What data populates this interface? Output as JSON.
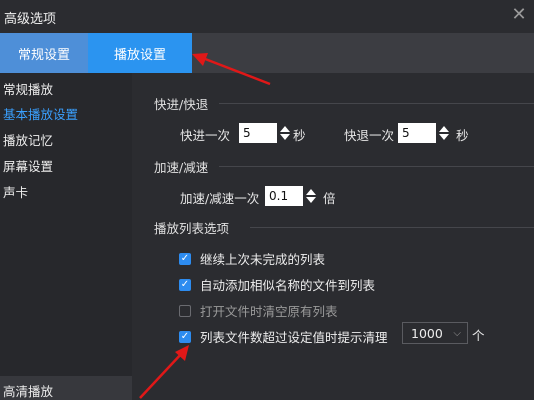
{
  "window": {
    "title": "高级选项",
    "close_glyph": "✕"
  },
  "tabs": [
    {
      "label": "常规设置"
    },
    {
      "label": "播放设置"
    }
  ],
  "sidebar": {
    "items": [
      {
        "label": "常规播放"
      },
      {
        "label": "基本播放设置"
      },
      {
        "label": "播放记忆"
      },
      {
        "label": "屏幕设置"
      },
      {
        "label": "声卡"
      }
    ],
    "bottom": "高清播放"
  },
  "sections": {
    "seek": {
      "title": "快进/快退",
      "forward_label": "快进一次",
      "forward_value": "5",
      "forward_unit": "秒",
      "backward_label": "快退一次",
      "backward_value": "5",
      "backward_unit": "秒"
    },
    "speed": {
      "title": "加速/减速",
      "label": "加速/减速一次",
      "value": "0.1",
      "unit": "倍"
    },
    "playlist": {
      "title": "播放列表选项",
      "options": [
        {
          "label": "继续上次未完成的列表",
          "checked": true
        },
        {
          "label": "自动添加相似名称的文件到列表",
          "checked": true
        },
        {
          "label": "打开文件时清空原有列表",
          "checked": false
        },
        {
          "label": "列表文件数超过设定值时提示清理",
          "checked": true
        }
      ],
      "limit_value": "1000",
      "limit_unit": "个"
    }
  },
  "colors": {
    "accent": "#2b94f0",
    "active_link": "#3aa0ff",
    "annotation_arrow": "#e01818"
  },
  "icons": {
    "close": "close-icon",
    "spin": "spinner-arrows-icon",
    "check": "checkbox-icon",
    "dropdown": "chevron-down-icon"
  }
}
